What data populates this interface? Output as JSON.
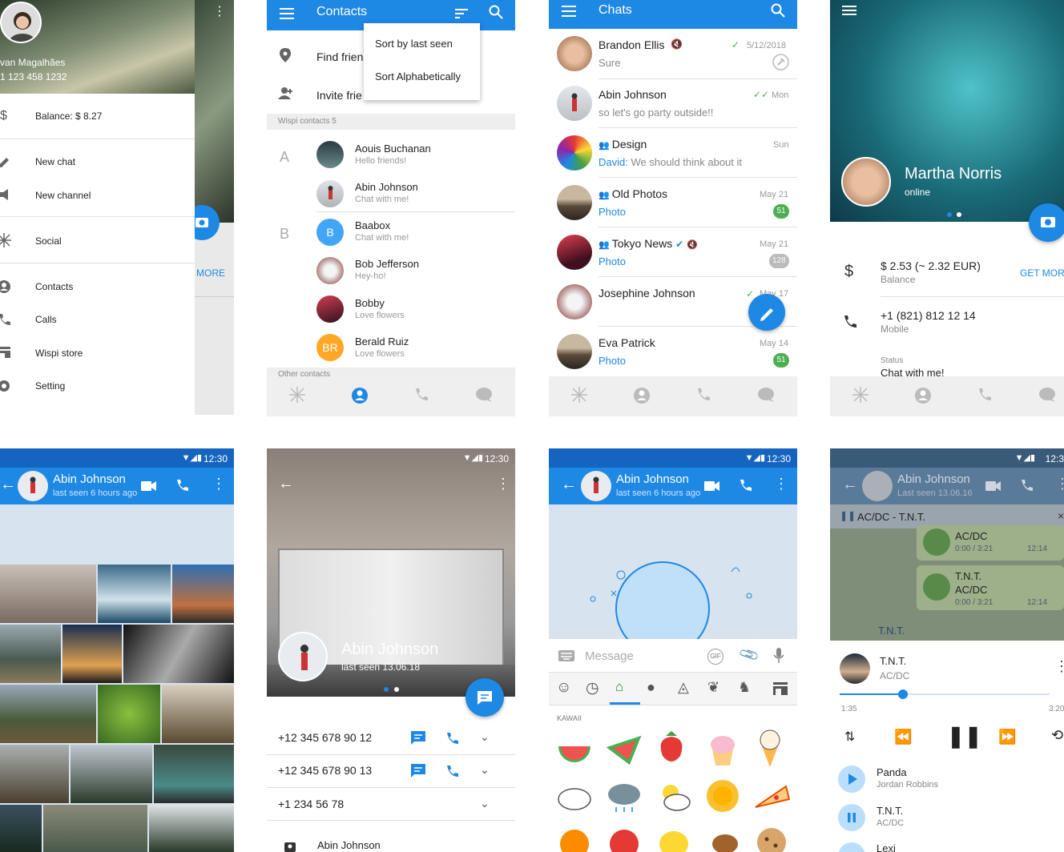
{
  "drawer": {
    "name": "van Magalhães",
    "phone": "1 123 458 1232",
    "balance": "Balance: $ 8.27",
    "more": "MORE",
    "items": [
      "New chat",
      "New channel",
      "Social",
      "Contacts",
      "Calls",
      "Wispi store",
      "Setting"
    ]
  },
  "contacts": {
    "title": "Contacts",
    "menu": [
      "Sort by last seen",
      "Sort Alphabetically"
    ],
    "find": "Find frien",
    "invite": "Invite frie",
    "section": "Wispi contacts 5",
    "other": "Other contacts",
    "letters": [
      "A",
      "B"
    ],
    "list": [
      {
        "name": "Aouis Buchanan",
        "sub": "Hello friends!"
      },
      {
        "name": "Abin Johnson",
        "sub": "Chat with me!"
      },
      {
        "name": "Baabox",
        "sub": "Chat with me!",
        "initial": "B"
      },
      {
        "name": "Bob Jefferson",
        "sub": "Hey-ho!"
      },
      {
        "name": "Bobby",
        "sub": "Love flowers"
      },
      {
        "name": "Berald Ruiz",
        "sub": "Love flowers",
        "initial": "BR"
      }
    ]
  },
  "chats": {
    "title": "Chats",
    "list": [
      {
        "name": "Brandon Ellis",
        "msg": "Sure",
        "date": "5/12/2018"
      },
      {
        "name": "Abin Johnson",
        "msg": "so let's go party outside!!",
        "date": "Mon"
      },
      {
        "name": "Design",
        "sender": "David:",
        "msg": "We should think about it",
        "date": "Sun"
      },
      {
        "name": "Old Photos",
        "msg": "Photo",
        "date": "May 21",
        "badge": "51"
      },
      {
        "name": "Tokyo News",
        "msg": "Photo",
        "date": "May 21",
        "badge": "128"
      },
      {
        "name": "Josephine Johnson",
        "msg": "",
        "date": "May 17"
      },
      {
        "name": "Eva Patrick",
        "msg": "Photo",
        "date": "May 14",
        "badge": "51"
      }
    ]
  },
  "profile": {
    "name": "Martha Norris",
    "status": "online",
    "balance_value": "$ 2.53 (~ 2.32 EUR)",
    "balance_label": "Balance",
    "get_more": "GET MORE",
    "phone": "+1 (821) 812 12 14",
    "phone_label": "Mobile",
    "status_label": "Status",
    "status_value": "Chat with me!"
  },
  "gallery": {
    "time": "12:30",
    "name": "Abin Johnson",
    "seen": "last seen 6 hours ago"
  },
  "contactinfo": {
    "time": "12:30",
    "name": "Abin Johnson",
    "seen": "last seen 13.06.18",
    "phones": [
      "+12 345 678 90 12",
      "+12 345 678 90 13",
      "+1 234 56 78"
    ],
    "bottom_name": "Abin Johnson"
  },
  "stickers": {
    "time": "12:30",
    "name": "Abin Johnson",
    "seen": "last seen 6 hours ago",
    "placeholder": "Message",
    "section": "KAWAII"
  },
  "music": {
    "time": "12:3",
    "name": "Abin Johnson",
    "seen": "Last seen 13.06.16",
    "now": "AC/DC - T.N.T.",
    "msgs": [
      {
        "title": "AC/DC",
        "dur": "0:00 / 3:21",
        "time": "12:14"
      },
      {
        "title": "T.N.T.",
        "sub": "AC/DC",
        "dur": "0:00 / 3:21",
        "time": "12:14"
      }
    ],
    "peek": "T.N.T.",
    "track": "T.N.T.",
    "artist": "AC/DC",
    "elapsed": "1:35",
    "total": "3:20",
    "progress": 0.3,
    "queue": [
      {
        "title": "Panda",
        "artist": "Jordan Robbins"
      },
      {
        "title": "T.N.T.",
        "artist": "AC/DC"
      },
      {
        "title": "Lexi",
        "artist": ""
      }
    ]
  },
  "colors": {
    "primary": "#1e88e5",
    "green": "#4caf50",
    "text": "#222",
    "secondary": "#888"
  }
}
